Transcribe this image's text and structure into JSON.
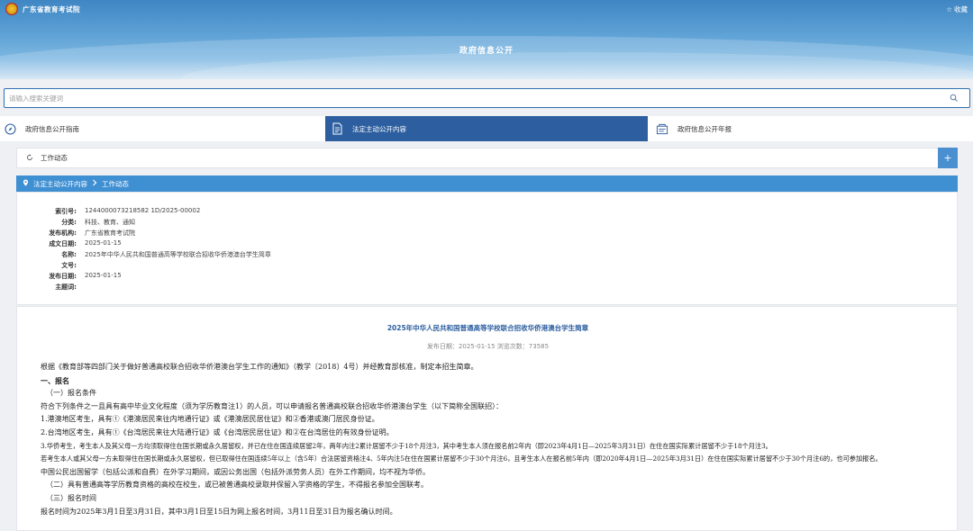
{
  "site": {
    "name": "广东省教育考试院",
    "favorite": "收藏"
  },
  "page_title": "政府信息公开",
  "search": {
    "placeholder": "请输入搜索关键词"
  },
  "tabs": [
    {
      "label": "政府信息公开指南",
      "active": false
    },
    {
      "label": "法定主动公开内容",
      "active": true
    },
    {
      "label": "政府信息公开年报",
      "active": false
    }
  ],
  "section": {
    "label": "工作动态",
    "plus": "+"
  },
  "breadcrumb": {
    "root": "法定主动公开内容",
    "current": "工作动态"
  },
  "meta": [
    {
      "key": "索引号:",
      "value": "1244000073218582 1D/2025-00002"
    },
    {
      "key": "分类:",
      "value": "科技、教育、通知"
    },
    {
      "key": "发布机构:",
      "value": "广东省教育考试院"
    },
    {
      "key": "成文日期:",
      "value": "2025-01-15"
    },
    {
      "key": "名称:",
      "value": "2025年中华人民共和国普通高等学校联合招收华侨港澳台学生简章"
    },
    {
      "key": "文号:",
      "value": ""
    },
    {
      "key": "发布日期:",
      "value": "2025-01-15"
    },
    {
      "key": "主题词:",
      "value": ""
    }
  ],
  "article": {
    "title": "2025年中华人民共和国普通高等学校联合招收华侨港澳台学生简章",
    "info": "发布日期：2025-01-15  浏览次数：73585",
    "lines": [
      "根据《教育部等四部门关于做好普通高校联合招收华侨港澳台学生工作的通知》（教学〔2018〕4号）并经教育部核准，制定本招生简章。",
      "一、报名",
      "（一）报名条件",
      "符合下列条件之一且具有高中毕业文化程度（须为学历教育注1）的人员，可以申请报名普通高校联合招收华侨港澳台学生（以下简称全国联招）：",
      "1.港澳地区考生，具有①《港澳居民来往内地通行证》或《港澳居民居住证》和②香港或澳门居民身份证。",
      "2.台湾地区考生，具有①《台湾居民来往大陆通行证》或《台湾居民居住证》和②在台湾居住的有效身份证明。",
      "3.华侨考生，考生本人及其父母一方均须取得住在国长期或永久居留权，并已在住在国连续居留2年，两年内注2累计居留不少于18个月注3，其中考生本人须在报名前2年内（即2023年4月1日—2025年3月31日）在住在国实际累计居留不少于18个月注3。",
      "若考生本人或其父母一方未取得住在国长期或永久居留权，但已取得住在国连续5年以上（含5年）合法居留资格注4、5年内注5在住在国累计居留不少于30个月注6，且考生本人在报名前5年内（即2020年4月1日—2025年3月31日）在住在国实际累计居留不少于30个月注6的，也可参加报名。",
      "中国公民出国留学（包括公派和自费）在外学习期间，或因公务出国（包括外派劳务人员）在外工作期间，均不视为华侨。",
      "（二）具有普通高等学历教育资格的高校在校生，或已被普通高校录取并保留入学资格的学生，不得报名参加全国联考。",
      "（三）报名时间",
      "报名时间为2025年3月1日至3月31日，其中3月1日至15日为网上报名时间，3月11日至31日为报名确认时间。"
    ]
  },
  "colors": {
    "primary": "#2d5fa0",
    "accent": "#3f8fd3",
    "plus": "#4a90d1"
  }
}
